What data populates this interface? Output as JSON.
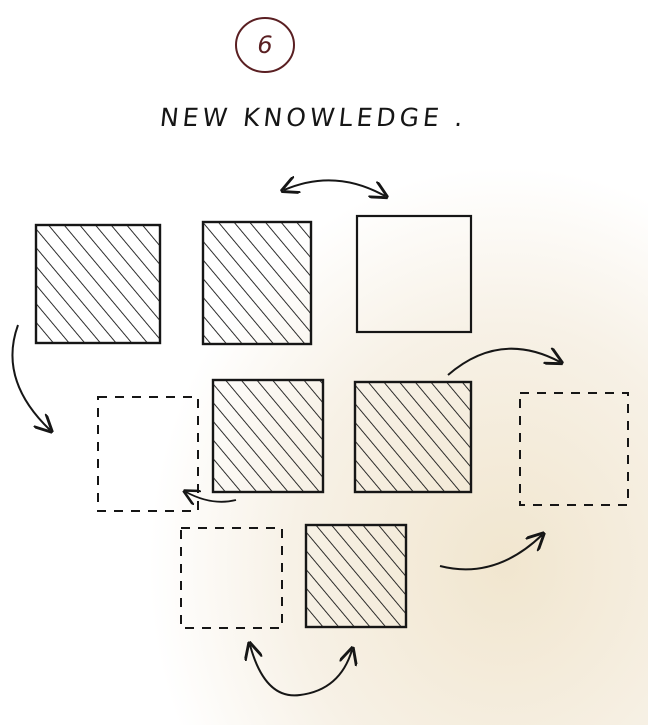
{
  "page_number": "6",
  "title": "NEW KNOWLEDGE .",
  "colors": {
    "ink": "#161616",
    "page_number_ink": "#5a1f22",
    "paper": "#ffffff",
    "paper_warm": "#f3ead8"
  },
  "rows": [
    {
      "name": "row-1",
      "squares": [
        {
          "name": "square-1a",
          "style": "hatched"
        },
        {
          "name": "square-1b",
          "style": "hatched"
        },
        {
          "name": "square-1c",
          "style": "empty-solid"
        }
      ]
    },
    {
      "name": "row-2",
      "squares": [
        {
          "name": "square-2a",
          "style": "empty-dashed"
        },
        {
          "name": "square-2b",
          "style": "hatched"
        },
        {
          "name": "square-2c",
          "style": "hatched"
        },
        {
          "name": "square-2d",
          "style": "empty-dashed"
        }
      ]
    },
    {
      "name": "row-3",
      "squares": [
        {
          "name": "square-3a",
          "style": "empty-dashed"
        },
        {
          "name": "square-3b",
          "style": "hatched"
        }
      ]
    }
  ],
  "arrows": [
    {
      "name": "swap-arrow-top",
      "kind": "double-headed",
      "description_icon": "double-arrow-icon"
    },
    {
      "name": "arrow-row1-to-row2-left",
      "kind": "single",
      "description_icon": "curved-arrow-icon"
    },
    {
      "name": "arrow-row2-to-right-dashed",
      "kind": "single",
      "description_icon": "curved-arrow-icon"
    },
    {
      "name": "arrow-small-left",
      "kind": "single",
      "description_icon": "curved-arrow-icon"
    },
    {
      "name": "arrow-row3-to-right-dashed",
      "kind": "single",
      "description_icon": "curved-arrow-icon"
    },
    {
      "name": "swap-arrow-bottom",
      "kind": "double-headed",
      "description_icon": "double-arrow-icon"
    }
  ]
}
